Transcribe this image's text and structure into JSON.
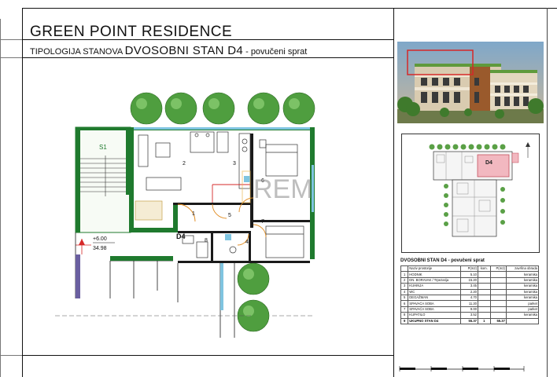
{
  "header": {
    "title": "GREEN POINT RESIDENCE",
    "subtitle_prefix": "TIPOLOGIJA STANOVA",
    "subtitle_unit": "DVOSOBNI STAN  D4",
    "subtitle_suffix": "- povučeni sprat"
  },
  "plan": {
    "stair_label": "S1",
    "unit_label": "D4",
    "level_top": "+6.00",
    "level_bottom": "34.98",
    "watermark": "REM",
    "room_numbers": [
      "1",
      "2",
      "3",
      "4",
      "5",
      "6",
      "7",
      "8",
      "9"
    ]
  },
  "keyplan": {
    "unit_label": "D4"
  },
  "table": {
    "title": "DVOSOBNI STAN D4 - povučeni sprat",
    "headers": [
      "",
      "Naziv prostorije",
      "P(m2)",
      "kom.",
      "P(m2)",
      "završna obrada"
    ],
    "rows": [
      {
        "no": "1",
        "name": "HODNIK",
        "area": "5.10",
        "finish": "keramika"
      },
      {
        "no": "2",
        "name": "DN. BORAVAK / Trpezarija",
        "area": "15.20",
        "finish": "keramika"
      },
      {
        "no": "3",
        "name": "KUHINJA",
        "area": "3.45",
        "finish": "keramika"
      },
      {
        "no": "4",
        "name": "WC",
        "area": "2.20",
        "finish": "keramika"
      },
      {
        "no": "5",
        "name": "DEGAŽMAN",
        "area": "4.70",
        "finish": "keramika"
      },
      {
        "no": "6",
        "name": "SPAVAĆA SOBA",
        "area": "11.20",
        "finish": "parket"
      },
      {
        "no": "7",
        "name": "SPAVAĆA SOBA",
        "area": "9.00",
        "finish": "parket"
      },
      {
        "no": "8",
        "name": "KUPATILO",
        "area": "3.52",
        "finish": "keramika"
      }
    ],
    "total": {
      "no": "9",
      "name": "UKUPNO STAN D4",
      "area": "55.37",
      "kom": "1",
      "sum": "55.37"
    }
  },
  "colors": {
    "wall_green": "#1f7a2e",
    "wall_dark": "#1a1a1a",
    "accent_red": "#d62828",
    "door_orange": "#e08a1e",
    "glass_blue": "#7fc4e0",
    "tree_green": "#3f9a3a",
    "keyplan_pink": "#f2b8c0"
  }
}
